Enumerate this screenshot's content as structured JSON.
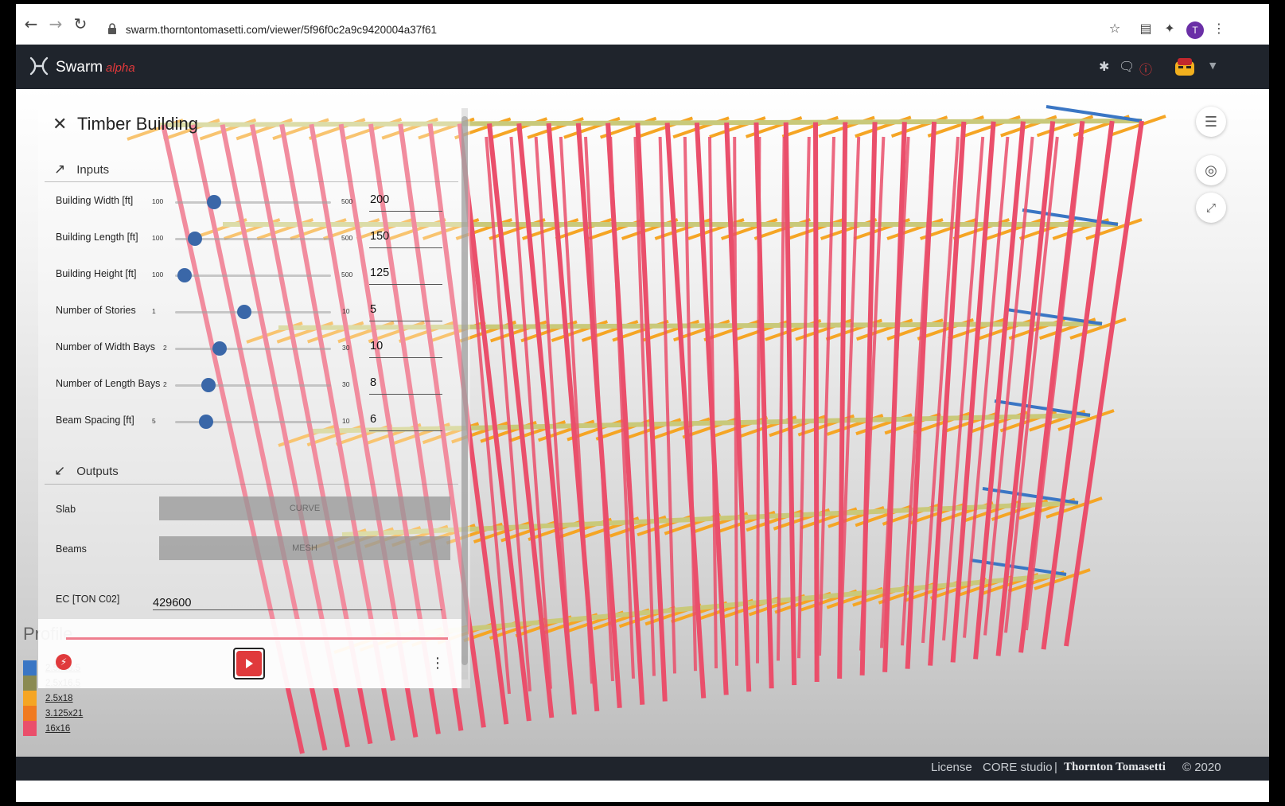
{
  "browser": {
    "url": "swarm.thorntontomasetti.com/viewer/5f96f0c2a9c9420004a37f61",
    "profile_initial": "T"
  },
  "app": {
    "name": "Swarm",
    "tag": "alpha"
  },
  "panel": {
    "title": "Timber Building",
    "inputs_label": "Inputs",
    "outputs_label": "Outputs",
    "inputs": [
      {
        "label": "Building Width [ft]",
        "min": "100",
        "max": "500",
        "value": "200",
        "level": 0.25
      },
      {
        "label": "Building Length [ft]",
        "min": "100",
        "max": "500",
        "value": "150",
        "level": 0.125
      },
      {
        "label": "Building Height [ft]",
        "min": "100",
        "max": "500",
        "value": "125",
        "level": 0.0625
      },
      {
        "label": "Number of Stories",
        "min": "1",
        "max": "10",
        "value": "5",
        "level": 0.444
      },
      {
        "label": "Number of Width Bays",
        "min": "2",
        "max": "30",
        "value": "10",
        "level": 0.286
      },
      {
        "label": "Number of Length Bays",
        "min": "2",
        "max": "30",
        "value": "8",
        "level": 0.214
      },
      {
        "label": "Beam Spacing [ft]",
        "min": "5",
        "max": "10",
        "value": "6",
        "level": 0.2
      }
    ],
    "outputs": [
      {
        "label": "Slab",
        "type": "CURVE"
      },
      {
        "label": "Beams",
        "type": "MESH"
      }
    ],
    "ec_label": "EC [TON C02]",
    "ec_value": "429600"
  },
  "legend": {
    "title": "Profile",
    "items": [
      {
        "label": "2.5x13.5",
        "color": "#3a76c4"
      },
      {
        "label": "2.5x16.5",
        "color": "#8a8a52"
      },
      {
        "label": "2.5x18",
        "color": "#f5a524"
      },
      {
        "label": "3.125x21",
        "color": "#f07a20"
      },
      {
        "label": "16x16",
        "color": "#ea4f6b"
      }
    ]
  },
  "footer": {
    "license": "License",
    "core": "CORE studio",
    "sep": "|",
    "company": "Thornton Tomasetti",
    "copyright": "© 2020"
  },
  "colors": {
    "column": "#ea4f6b",
    "beam": "#f5a524",
    "slab_edge": "#c9c97a",
    "edge_beam": "#3a76c4",
    "accent": "#e03a3c"
  }
}
